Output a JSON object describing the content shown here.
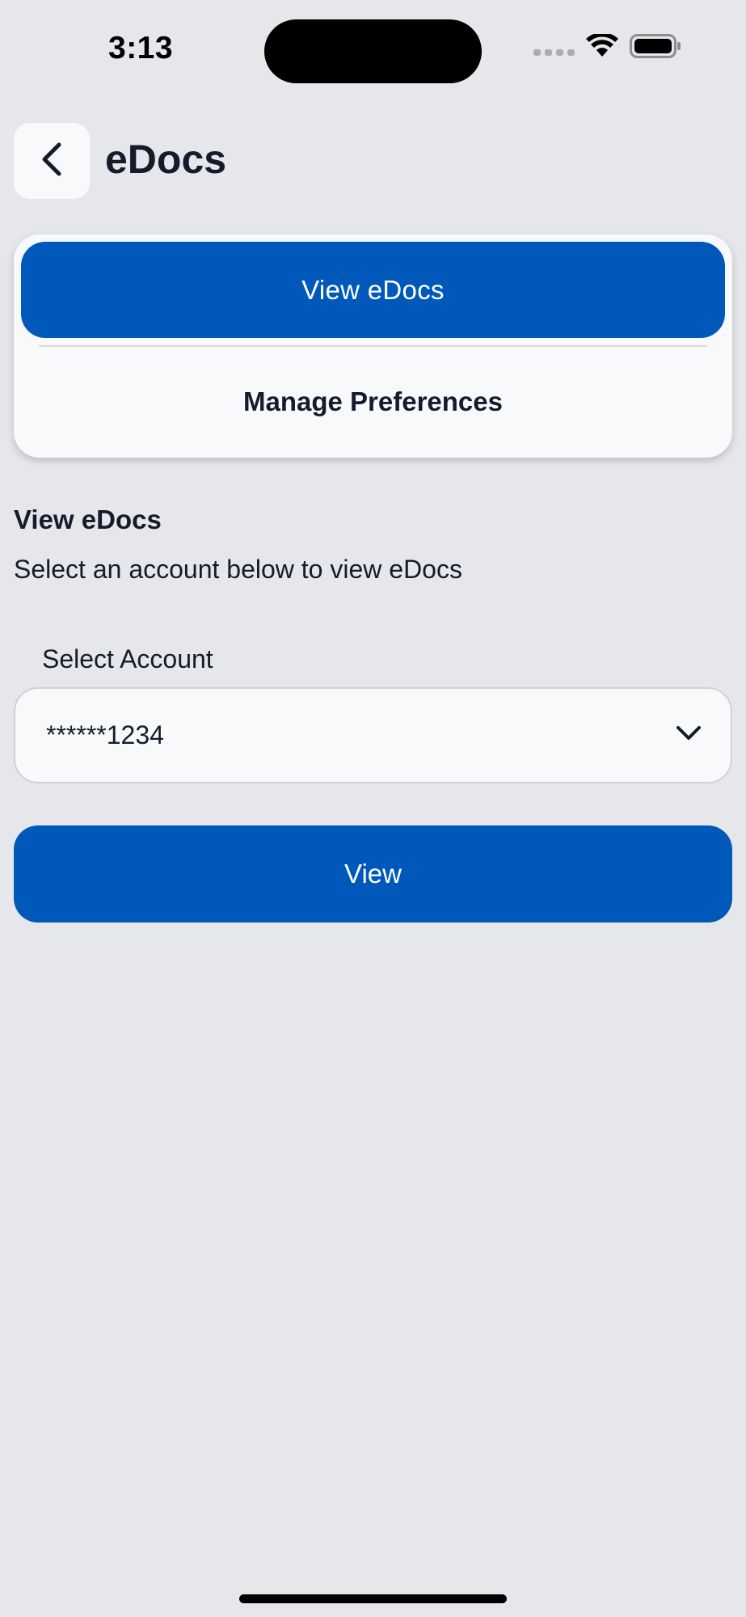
{
  "status_bar": {
    "time": "3:13"
  },
  "header": {
    "title": "eDocs",
    "back_icon": "chevron-left-icon"
  },
  "segmented_control": {
    "active_label": "View eDocs",
    "inactive_label": "Manage Preferences"
  },
  "section": {
    "title": "View eDocs",
    "description": "Select an account below to view eDocs"
  },
  "account_select": {
    "label": "Select Account",
    "value": "******1234",
    "icon": "chevron-down-icon"
  },
  "view_button": {
    "label": "View"
  },
  "colors": {
    "primary": "#0058bb",
    "background": "#e6e7eb",
    "surface": "#f8f9fb",
    "text": "#161b2c"
  }
}
